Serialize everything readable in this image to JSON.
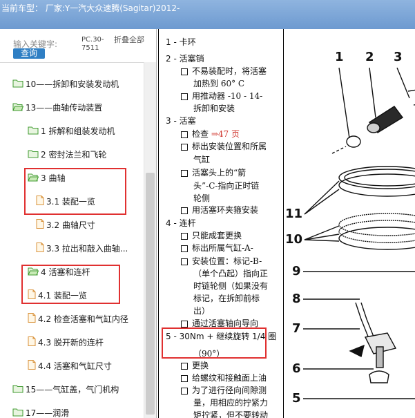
{
  "window": {
    "title": "当前车型：  厂家:Y一汽大众速腾(Sagitar)2012-"
  },
  "search": {
    "keyword_label": "输入关键字:",
    "query_button": "查询",
    "code": "PC.30-7511",
    "fold_label": "折叠全部"
  },
  "tree": {
    "items": [
      {
        "label": "10——拆卸和安装发动机",
        "icon": "folder-icon"
      },
      {
        "label": "13——曲轴传动装置",
        "icon": "folder-open-icon"
      },
      {
        "label": "1 拆解和组装发动机",
        "icon": "folder-icon"
      },
      {
        "label": "2 密封法兰和飞轮",
        "icon": "folder-icon"
      },
      {
        "label": "3 曲轴",
        "icon": "folder-open-icon"
      },
      {
        "label": "3.1 装配一览",
        "icon": "document-icon"
      },
      {
        "label": "3.2 曲轴尺寸",
        "icon": "document-icon"
      },
      {
        "label": "3.3 拉出和敲入曲轴...",
        "icon": "document-icon"
      },
      {
        "label": "4 活塞和连杆",
        "icon": "folder-open-icon"
      },
      {
        "label": "4.1 装配一览",
        "icon": "document-icon"
      },
      {
        "label": "4.2 检查活塞和气缸内径",
        "icon": "document-icon"
      },
      {
        "label": "4.3 脱开新的连杆",
        "icon": "document-icon"
      },
      {
        "label": "4.4 活塞和气缸尺寸",
        "icon": "document-icon"
      },
      {
        "label": "15——气缸盖，气门机构",
        "icon": "folder-icon"
      },
      {
        "label": "17——润滑",
        "icon": "folder-icon"
      }
    ]
  },
  "doc": {
    "lines": [
      {
        "type": "h",
        "text": "1 - 卡环"
      },
      {
        "type": "h",
        "text": "2 - 活塞销"
      },
      {
        "type": "c",
        "text": "不易装配时，将活塞"
      },
      {
        "type": "t",
        "text": "加热到 60° C"
      },
      {
        "type": "c",
        "text": "用推动器 -10 - 14-"
      },
      {
        "type": "t",
        "text": "拆卸和安装"
      },
      {
        "type": "h",
        "text": "3 - 活塞"
      },
      {
        "type": "c",
        "text": "检查 ",
        "link": "⇒47 页"
      },
      {
        "type": "c",
        "text": "标出安装位置和所属"
      },
      {
        "type": "t",
        "text": "气缸"
      },
      {
        "type": "c",
        "text": "活塞头上的“箭"
      },
      {
        "type": "t",
        "text": "头”-C-指向正时链"
      },
      {
        "type": "t",
        "text": "轮侧"
      },
      {
        "type": "c",
        "text": "用活塞环夹箍安装"
      },
      {
        "type": "h",
        "text": "4 - 连杆"
      },
      {
        "type": "c",
        "text": "只能成套更换"
      },
      {
        "type": "c",
        "text": "标出所属气缸-A-"
      },
      {
        "type": "c",
        "text": "安装位置：标记-B-"
      },
      {
        "type": "t",
        "text": "（单个凸起）指向正"
      },
      {
        "type": "t",
        "text": "时链轮侧（如果没有"
      },
      {
        "type": "t",
        "text": "标记，在拆卸前标"
      },
      {
        "type": "t",
        "text": "出）"
      },
      {
        "type": "c",
        "text": "通过活塞轴向导向"
      },
      {
        "type": "h",
        "text": "5 - 30Nm + 继续旋转 1/4 圈"
      },
      {
        "type": "t",
        "text": "（90°）"
      },
      {
        "type": "c",
        "text": "更换"
      },
      {
        "type": "c",
        "text": "给螺纹和接触面上油"
      },
      {
        "type": "c",
        "text": "为了进行径向间隙测"
      },
      {
        "type": "t",
        "text": "量，用相应的拧紧力"
      },
      {
        "type": "t",
        "text": "矩拧紧，但不要转动"
      }
    ]
  },
  "diagram": {
    "callouts": [
      "1",
      "2",
      "3",
      "11",
      "10",
      "9",
      "8",
      "7",
      "6",
      "5"
    ]
  }
}
